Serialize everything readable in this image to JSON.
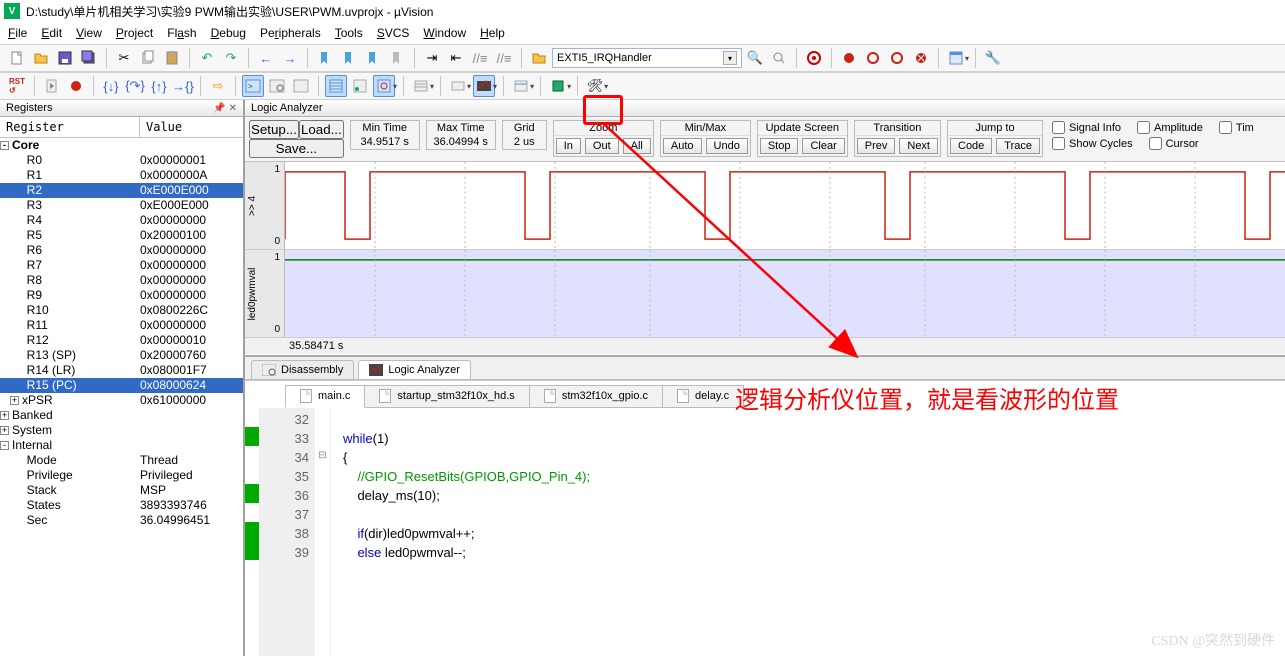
{
  "window": {
    "title": "D:\\study\\单片机相关学习\\实验9 PWM输出实验\\USER\\PWM.uvprojx - µVision"
  },
  "menu": {
    "file": "File",
    "edit": "Edit",
    "view": "View",
    "project": "Project",
    "flash": "Flash",
    "debug": "Debug",
    "peripherals": "Peripherals",
    "tools": "Tools",
    "svcs": "SVCS",
    "window": "Window",
    "help": "Help"
  },
  "combo": {
    "value": "EXTI5_IRQHandler"
  },
  "registers": {
    "title": "Registers",
    "col_reg": "Register",
    "col_val": "Value",
    "core": "Core",
    "rows": [
      {
        "lbl": "R0",
        "val": "0x00000001"
      },
      {
        "lbl": "R1",
        "val": "0x0000000A"
      },
      {
        "lbl": "R2",
        "val": "0xE000E000",
        "sel": true
      },
      {
        "lbl": "R3",
        "val": "0xE000E000"
      },
      {
        "lbl": "R4",
        "val": "0x00000000"
      },
      {
        "lbl": "R5",
        "val": "0x20000100"
      },
      {
        "lbl": "R6",
        "val": "0x00000000"
      },
      {
        "lbl": "R7",
        "val": "0x00000000"
      },
      {
        "lbl": "R8",
        "val": "0x00000000"
      },
      {
        "lbl": "R9",
        "val": "0x00000000"
      },
      {
        "lbl": "R10",
        "val": "0x0800226C"
      },
      {
        "lbl": "R11",
        "val": "0x00000000"
      },
      {
        "lbl": "R12",
        "val": "0x00000010"
      },
      {
        "lbl": "R13 (SP)",
        "val": "0x20000760"
      },
      {
        "lbl": "R14 (LR)",
        "val": "0x080001F7"
      },
      {
        "lbl": "R15 (PC)",
        "val": "0x08000624",
        "sel": true
      },
      {
        "lbl": "xPSR",
        "val": "0x61000000",
        "plus": true
      }
    ],
    "banked": "Banked",
    "system": "System",
    "internal": "Internal",
    "int_rows": [
      {
        "lbl": "Mode",
        "val": "Thread"
      },
      {
        "lbl": "Privilege",
        "val": "Privileged"
      },
      {
        "lbl": "Stack",
        "val": "MSP"
      },
      {
        "lbl": "States",
        "val": "3893393746"
      },
      {
        "lbl": "Sec",
        "val": "36.04996451"
      }
    ]
  },
  "la": {
    "title": "Logic Analyzer",
    "setup": "Setup...",
    "load": "Load...",
    "save": "Save...",
    "mint_h": "Min Time",
    "mint_v": "34.9517 s",
    "maxt_h": "Max Time",
    "maxt_v": "36.04994 s",
    "grid_h": "Grid",
    "grid_v": "2 us",
    "zoom_h": "Zoom",
    "in": "In",
    "out": "Out",
    "all": "All",
    "minmax_h": "Min/Max",
    "auto": "Auto",
    "undo": "Undo",
    "upd_h": "Update Screen",
    "stop": "Stop",
    "clear": "Clear",
    "trans_h": "Transition",
    "prev": "Prev",
    "next": "Next",
    "jump_h": "Jump to",
    "code": "Code",
    "trace": "Trace",
    "sig": "Signal Info",
    "amp": "Amplitude",
    "tim": "Tim",
    "cyc": "Show Cycles",
    "cur": "Cursor",
    "sig1": ">> 4",
    "sig2": "led0pwmval",
    "timebar": "35.58471 s"
  },
  "tabs": {
    "disasm": "Disassembly",
    "la": "Logic Analyzer"
  },
  "files": {
    "main": "main.c",
    "startup": "startup_stm32f10x_hd.s",
    "gpio": "stm32f10x_gpio.c",
    "delay": "delay.c"
  },
  "code": {
    "lines": [
      32,
      33,
      34,
      35,
      36,
      37,
      38,
      39
    ],
    "l33_kw": "while",
    "l33_p": "(",
    "l33_n": "1",
    "l33_c": ")",
    "l34": "{",
    "l35": "//GPIO_ResetBits(GPIOB,GPIO_Pin_4);",
    "l36a": "delay_ms(",
    "l36n": "10",
    "l36b": ");",
    "l38_kw": "if",
    "l38_rest": "(dir)led0pwmval++;",
    "l39_kw": "else",
    "l39_rest": " led0pwmval--;"
  },
  "annotation": {
    "text": "逻辑分析仪位置，就是看波形的位置"
  },
  "watermark": {
    "text": "CSDN @突然到硬件"
  }
}
